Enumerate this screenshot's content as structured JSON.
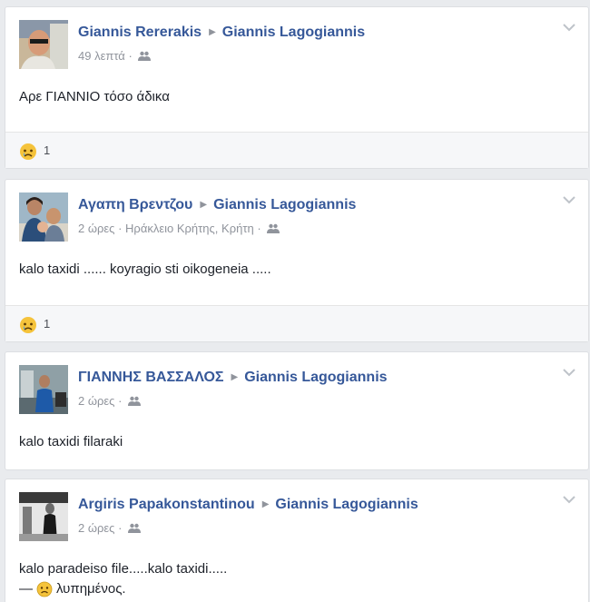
{
  "posts": [
    {
      "author": "Giannis Rererakis",
      "target": "Giannis Lagogiannis",
      "time": "49 λεπτά",
      "location": "",
      "text": "Αρε ΓΙΑΝΝΙΟ τόσο άδικα",
      "reaction_icon": "sad-emoji-icon",
      "reaction_count": "1"
    },
    {
      "author": "Αγαπη Βρεντζου",
      "target": "Giannis Lagogiannis",
      "time": "2 ώρες",
      "location": "Ηράκλειο Κρήτης, Κρήτη",
      "text": "kalo taxidi ...... koyragio sti oikogeneia .....",
      "reaction_icon": "sad-emoji-icon",
      "reaction_count": "1"
    },
    {
      "author": "ΓΙΑΝΝΗΣ ΒΑΣΣΑΛΟΣ",
      "target": "Giannis Lagogiannis",
      "time": "2 ώρες",
      "location": "",
      "text": "kalo taxidi filaraki"
    },
    {
      "author": "Argiris Papakonstantinou",
      "target": "Giannis Lagogiannis",
      "time": "2 ώρες",
      "location": "",
      "text": "kalo paradeiso file.....kalo taxidi.....",
      "feeling_prefix": "—",
      "feeling": "λυπημένος."
    }
  ],
  "separator": "·",
  "colors": {
    "link": "#365899",
    "meta": "#90949c",
    "background": "#e9ebee",
    "sad_emoji": "#f5c33b"
  },
  "icons": {
    "audience": "friends-audience-icon",
    "chevron": "chevron-down-icon",
    "name_arrow": "right-triangle-icon"
  }
}
